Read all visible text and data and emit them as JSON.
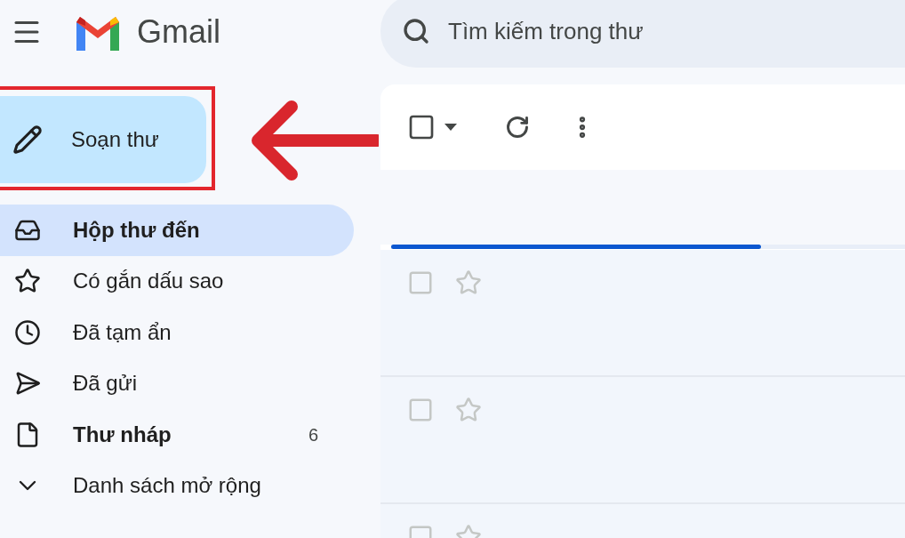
{
  "header": {
    "logo_text": "Gmail",
    "search": {
      "placeholder": "Tìm kiếm trong thư"
    }
  },
  "compose": {
    "label": "Soạn thư"
  },
  "nav": [
    {
      "label": "Hộp thư đến",
      "selected": true,
      "bold": true
    },
    {
      "label": "Có gắn dấu sao",
      "selected": false,
      "bold": false
    },
    {
      "label": "Đã tạm ẩn",
      "selected": false,
      "bold": false
    },
    {
      "label": "Đã gửi",
      "selected": false,
      "bold": false
    },
    {
      "label": "Thư nháp",
      "selected": false,
      "bold": true,
      "count": "6"
    },
    {
      "label": "Danh sách mở rộng",
      "selected": false,
      "bold": false
    }
  ],
  "toolbar": {
    "select_all_checked": false
  },
  "progress": {
    "level": 0.72
  },
  "rows": [
    {
      "checked": false,
      "starred": false
    },
    {
      "checked": false,
      "starred": false
    },
    {
      "checked": false,
      "starred": false
    }
  ]
}
